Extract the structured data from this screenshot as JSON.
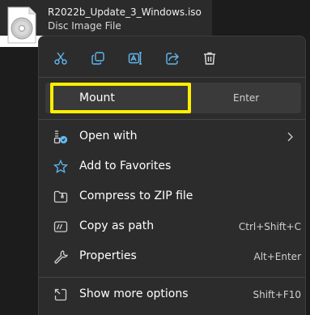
{
  "file": {
    "name": "R2022b_Update_3_Windows.iso",
    "type": "Disc Image File",
    "icon": "disc-icon"
  },
  "toolbar": [
    {
      "name": "cut",
      "icon": "scissors-icon"
    },
    {
      "name": "copy",
      "icon": "copy-icon"
    },
    {
      "name": "rename",
      "icon": "rename-icon"
    },
    {
      "name": "share",
      "icon": "share-icon"
    },
    {
      "name": "delete",
      "icon": "trash-icon"
    }
  ],
  "menu": {
    "mount": {
      "label": "Mount",
      "shortcut": "Enter",
      "highlight_color": "#ffee00"
    },
    "items": [
      {
        "label": "Open with",
        "shortcut": "",
        "icon": "open-with-icon",
        "has_submenu": true
      },
      {
        "label": "Add to Favorites",
        "shortcut": "",
        "icon": "star-icon"
      },
      {
        "label": "Compress to ZIP file",
        "shortcut": "",
        "icon": "zip-folder-icon"
      },
      {
        "label": "Copy as path",
        "shortcut": "Ctrl+Shift+C",
        "icon": "copy-path-icon"
      },
      {
        "label": "Properties",
        "shortcut": "Alt+Enter",
        "icon": "wrench-icon"
      }
    ],
    "more": {
      "label": "Show more options",
      "shortcut": "Shift+F10",
      "icon": "show-more-icon"
    }
  },
  "colors": {
    "accent": "#60b8f0",
    "menu_bg": "#2c2c2c",
    "highlight": "#ffee00"
  }
}
